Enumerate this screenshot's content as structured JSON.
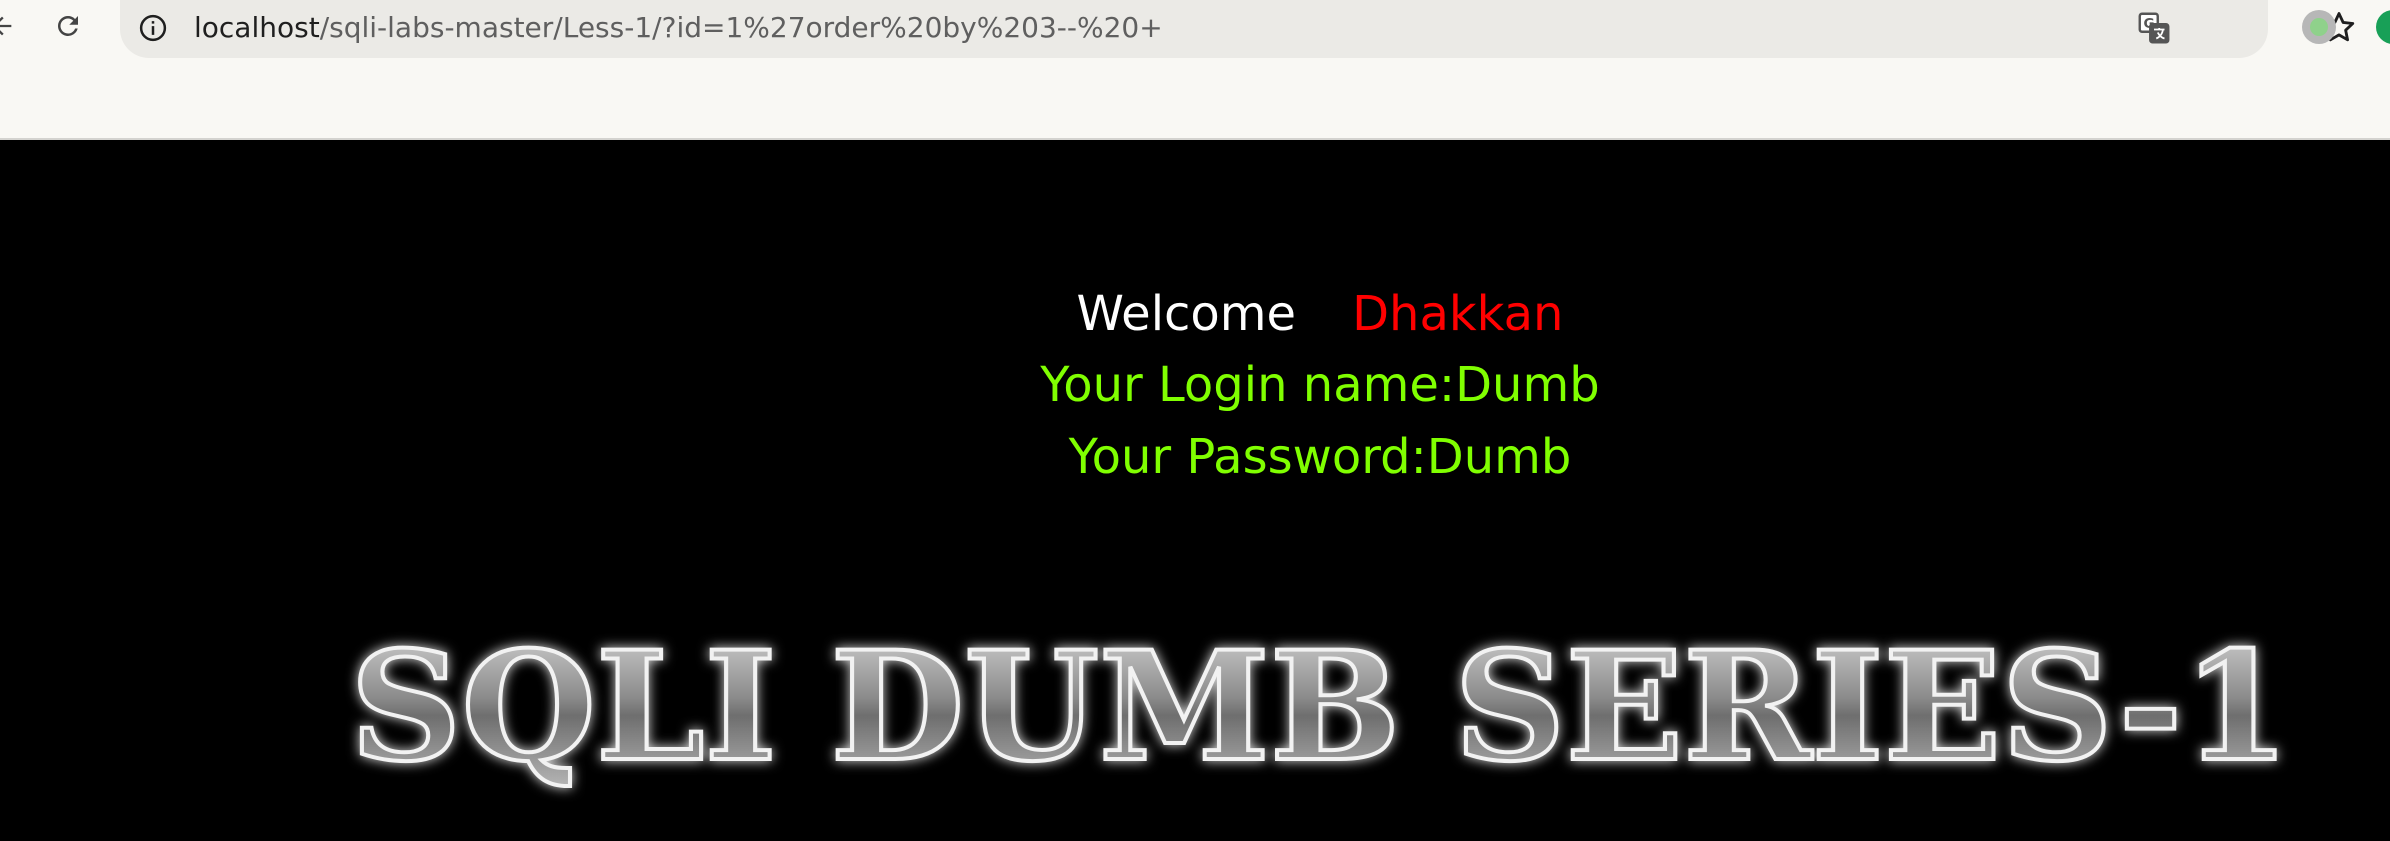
{
  "browser": {
    "url_host": "localhost",
    "url_path": "/sqli-labs-master/Less-1/?id=1%27order%20by%203--%20+",
    "icons": [
      "back-arrow-icon",
      "reload-icon",
      "info-icon",
      "translate-icon",
      "star-icon",
      "profile-icon",
      "extension-icon"
    ]
  },
  "page": {
    "welcome_word": "Welcome",
    "welcome_name": "Dhakkan",
    "login_line": "Your Login name:Dumb",
    "password_line": "Your Password:Dumb",
    "banner_text": "SQLI DUMB SERIES-1",
    "colors": {
      "background": "#000000",
      "welcome": "#ffffff",
      "name": "#ff0000",
      "info": "#80ff00"
    }
  }
}
